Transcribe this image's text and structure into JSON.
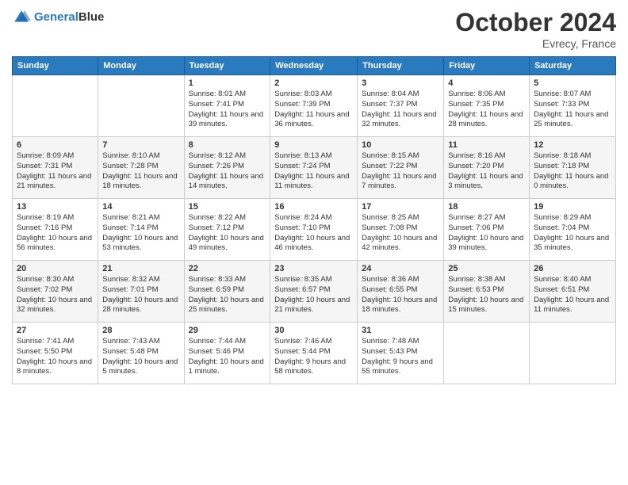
{
  "logo": {
    "line1": "General",
    "line2": "Blue"
  },
  "title": "October 2024",
  "location": "Evrecy, France",
  "days_header": [
    "Sunday",
    "Monday",
    "Tuesday",
    "Wednesday",
    "Thursday",
    "Friday",
    "Saturday"
  ],
  "weeks": [
    [
      {
        "day": "",
        "info": ""
      },
      {
        "day": "",
        "info": ""
      },
      {
        "day": "1",
        "info": "Sunrise: 8:01 AM\nSunset: 7:41 PM\nDaylight: 11 hours and 39 minutes."
      },
      {
        "day": "2",
        "info": "Sunrise: 8:03 AM\nSunset: 7:39 PM\nDaylight: 11 hours and 36 minutes."
      },
      {
        "day": "3",
        "info": "Sunrise: 8:04 AM\nSunset: 7:37 PM\nDaylight: 11 hours and 32 minutes."
      },
      {
        "day": "4",
        "info": "Sunrise: 8:06 AM\nSunset: 7:35 PM\nDaylight: 11 hours and 28 minutes."
      },
      {
        "day": "5",
        "info": "Sunrise: 8:07 AM\nSunset: 7:33 PM\nDaylight: 11 hours and 25 minutes."
      }
    ],
    [
      {
        "day": "6",
        "info": "Sunrise: 8:09 AM\nSunset: 7:31 PM\nDaylight: 11 hours and 21 minutes."
      },
      {
        "day": "7",
        "info": "Sunrise: 8:10 AM\nSunset: 7:28 PM\nDaylight: 11 hours and 18 minutes."
      },
      {
        "day": "8",
        "info": "Sunrise: 8:12 AM\nSunset: 7:26 PM\nDaylight: 11 hours and 14 minutes."
      },
      {
        "day": "9",
        "info": "Sunrise: 8:13 AM\nSunset: 7:24 PM\nDaylight: 11 hours and 11 minutes."
      },
      {
        "day": "10",
        "info": "Sunrise: 8:15 AM\nSunset: 7:22 PM\nDaylight: 11 hours and 7 minutes."
      },
      {
        "day": "11",
        "info": "Sunrise: 8:16 AM\nSunset: 7:20 PM\nDaylight: 11 hours and 3 minutes."
      },
      {
        "day": "12",
        "info": "Sunrise: 8:18 AM\nSunset: 7:18 PM\nDaylight: 11 hours and 0 minutes."
      }
    ],
    [
      {
        "day": "13",
        "info": "Sunrise: 8:19 AM\nSunset: 7:16 PM\nDaylight: 10 hours and 56 minutes."
      },
      {
        "day": "14",
        "info": "Sunrise: 8:21 AM\nSunset: 7:14 PM\nDaylight: 10 hours and 53 minutes."
      },
      {
        "day": "15",
        "info": "Sunrise: 8:22 AM\nSunset: 7:12 PM\nDaylight: 10 hours and 49 minutes."
      },
      {
        "day": "16",
        "info": "Sunrise: 8:24 AM\nSunset: 7:10 PM\nDaylight: 10 hours and 46 minutes."
      },
      {
        "day": "17",
        "info": "Sunrise: 8:25 AM\nSunset: 7:08 PM\nDaylight: 10 hours and 42 minutes."
      },
      {
        "day": "18",
        "info": "Sunrise: 8:27 AM\nSunset: 7:06 PM\nDaylight: 10 hours and 39 minutes."
      },
      {
        "day": "19",
        "info": "Sunrise: 8:29 AM\nSunset: 7:04 PM\nDaylight: 10 hours and 35 minutes."
      }
    ],
    [
      {
        "day": "20",
        "info": "Sunrise: 8:30 AM\nSunset: 7:02 PM\nDaylight: 10 hours and 32 minutes."
      },
      {
        "day": "21",
        "info": "Sunrise: 8:32 AM\nSunset: 7:01 PM\nDaylight: 10 hours and 28 minutes."
      },
      {
        "day": "22",
        "info": "Sunrise: 8:33 AM\nSunset: 6:59 PM\nDaylight: 10 hours and 25 minutes."
      },
      {
        "day": "23",
        "info": "Sunrise: 8:35 AM\nSunset: 6:57 PM\nDaylight: 10 hours and 21 minutes."
      },
      {
        "day": "24",
        "info": "Sunrise: 8:36 AM\nSunset: 6:55 PM\nDaylight: 10 hours and 18 minutes."
      },
      {
        "day": "25",
        "info": "Sunrise: 8:38 AM\nSunset: 6:53 PM\nDaylight: 10 hours and 15 minutes."
      },
      {
        "day": "26",
        "info": "Sunrise: 8:40 AM\nSunset: 6:51 PM\nDaylight: 10 hours and 11 minutes."
      }
    ],
    [
      {
        "day": "27",
        "info": "Sunrise: 7:41 AM\nSunset: 5:50 PM\nDaylight: 10 hours and 8 minutes."
      },
      {
        "day": "28",
        "info": "Sunrise: 7:43 AM\nSunset: 5:48 PM\nDaylight: 10 hours and 5 minutes."
      },
      {
        "day": "29",
        "info": "Sunrise: 7:44 AM\nSunset: 5:46 PM\nDaylight: 10 hours and 1 minute."
      },
      {
        "day": "30",
        "info": "Sunrise: 7:46 AM\nSunset: 5:44 PM\nDaylight: 9 hours and 58 minutes."
      },
      {
        "day": "31",
        "info": "Sunrise: 7:48 AM\nSunset: 5:43 PM\nDaylight: 9 hours and 55 minutes."
      },
      {
        "day": "",
        "info": ""
      },
      {
        "day": "",
        "info": ""
      }
    ]
  ]
}
